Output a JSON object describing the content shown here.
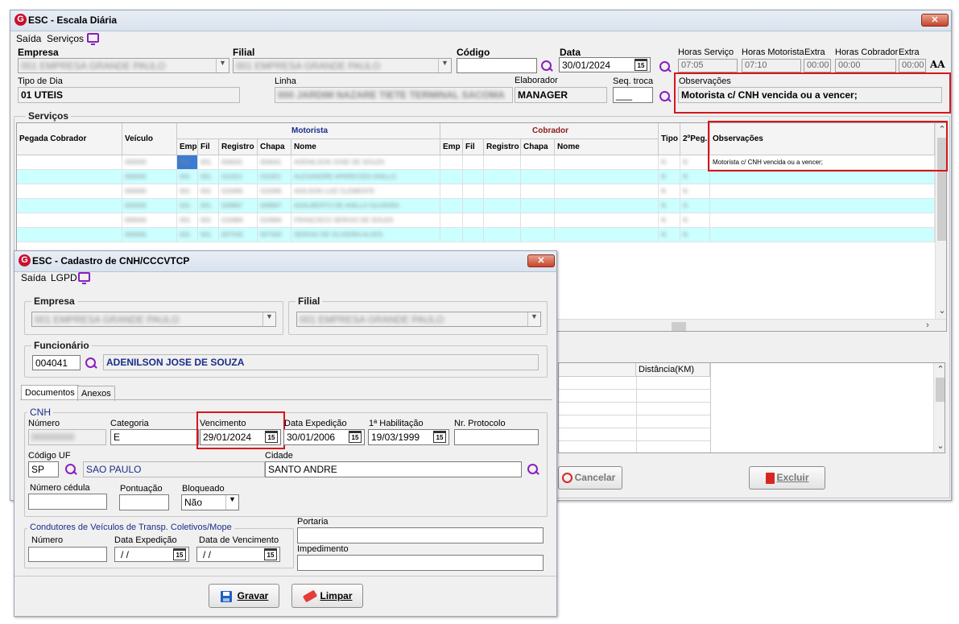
{
  "main": {
    "title": "ESC - Escala Diária",
    "close": "✕",
    "menu": [
      "Saída",
      "Serviços"
    ],
    "fields": {
      "empresa_label": "Empresa",
      "empresa_value": "001 EMPRESA GRANDE PAULO",
      "filial_label": "Filial",
      "filial_value": "001 EMPRESA GRANDE PAULO",
      "codigo_label": "Código",
      "data_label": "Data",
      "data_value": "30/01/2024",
      "horas_servico_label": "Horas Serviço",
      "horas_servico_value": "07:05",
      "horas_motorista_label": "Horas Motorista",
      "horas_motorista_value": "07:10",
      "extra_label": "Extra",
      "extra_motorista_value": "00:00",
      "horas_cobrador_label": "Horas Cobrador",
      "horas_cobrador_value": "00:00",
      "extra_cobrador_value": "00:00",
      "tipo_dia_label": "Tipo de Dia",
      "tipo_dia_value": "01 UTEIS",
      "linha_label": "Linha",
      "linha_value": "000 JARDIM NAZARE TIETE TERMINAL SACOMA",
      "elaborador_label": "Elaborador",
      "elaborador_value": "MANAGER",
      "seq_troca_label": "Seq. troca",
      "seq_troca_value": "___",
      "observacoes_label": "Observações",
      "observacoes_value": "Motorista c/ CNH vencida ou a vencer;"
    },
    "servicos": {
      "title": "Serviços",
      "headers": {
        "pegada_cobrador": "Pegada Cobrador",
        "veiculo": "Veículo",
        "motorista": "Motorista",
        "cobrador": "Cobrador",
        "emp": "Emp",
        "fil": "Fil",
        "registro": "Registro",
        "chapa": "Chapa",
        "nome": "Nome",
        "tipo": "Tipo",
        "peg2": "2ºPeg.",
        "observacoes": "Observações"
      },
      "rows": [
        {
          "veiculo": "000000",
          "emp": "001",
          "fil": "001",
          "registro": "004041",
          "chapa": "004041",
          "nome": "ADENILSON JOSE DE SOUZA",
          "tipo": "N",
          "peg2": "N",
          "obs": "Motorista c/ CNH vencida ou a vencer;"
        },
        {
          "veiculo": "000000",
          "emp": "001",
          "fil": "001",
          "registro": "011921",
          "chapa": "011921",
          "nome": "ALEXANDRE APARECIDO ANILLO",
          "tipo": "N",
          "peg2": "N",
          "obs": ""
        },
        {
          "veiculo": "000000",
          "emp": "001",
          "fil": "001",
          "registro": "010095",
          "chapa": "010095",
          "nome": "ADILSON LUIZ CLEMENTE",
          "tipo": "N",
          "peg2": "N",
          "obs": ""
        },
        {
          "veiculo": "000000",
          "emp": "001",
          "fil": "001",
          "registro": "009897",
          "chapa": "009897",
          "nome": "ADALBERTO DE ANILLO OLIVEIRA",
          "tipo": "N",
          "peg2": "N",
          "obs": ""
        },
        {
          "veiculo": "000000",
          "emp": "001",
          "fil": "001",
          "registro": "010684",
          "chapa": "010684",
          "nome": "FRANCISCO SERGIO DE SOUZA",
          "tipo": "N",
          "peg2": "N",
          "obs": ""
        },
        {
          "veiculo": "000000",
          "emp": "001",
          "fil": "001",
          "registro": "007540",
          "chapa": "007540",
          "nome": "SERGIO DE OLIVEIRA ALVES",
          "tipo": "N",
          "peg2": "N",
          "obs": ""
        }
      ]
    },
    "lower_grid": {
      "distancia_label": "Distância(KM)"
    },
    "buttons": {
      "cancelar": "Cancelar",
      "excluir": "Excluir"
    }
  },
  "cnh": {
    "title": "ESC - Cadastro de CNH/CCCVTCP",
    "close": "✕",
    "menu": [
      "Saída",
      "LGPD"
    ],
    "empresa_label": "Empresa",
    "empresa_value": "001 EMPRESA GRANDE PAULO",
    "filial_label": "Filial",
    "filial_value": "001 EMPRESA GRANDE PAULO",
    "funcionario_label": "Funcionário",
    "funcionario_codigo": "004041",
    "funcionario_nome": "ADENILSON JOSE DE SOUZA",
    "tabs": [
      "Documentos",
      "Anexos"
    ],
    "cnh_group": "CNH",
    "numero_label": "Número",
    "numero_value": "00000000",
    "categoria_label": "Categoria",
    "categoria_value": "E",
    "vencimento_label": "Vencimento",
    "vencimento_value": "29/01/2024",
    "data_expedicao_label": "Data Expedição",
    "data_expedicao_value": "30/01/2006",
    "habilitacao_label": "1ª Habilitação",
    "habilitacao_value": "19/03/1999",
    "protocolo_label": "Nr. Protocolo",
    "codigo_uf_label": "Código UF",
    "codigo_uf_value": "SP",
    "uf_nome": "SAO PAULO",
    "cidade_label": "Cidade",
    "cidade_value": "SANTO ANDRE",
    "numero_cedula_label": "Número cédula",
    "pontuacao_label": "Pontuação",
    "bloqueado_label": "Bloqueado",
    "bloqueado_value": "Não",
    "condutores_group": "Condutores de Veículos de Transp. Coletivos/Mope",
    "cond_numero_label": "Número",
    "cond_expedicao_label": "Data Expedição",
    "cond_expedicao_value": "/ /",
    "cond_vencimento_label": "Data de Vencimento",
    "cond_vencimento_value": "/ /",
    "portaria_label": "Portaria",
    "impedimento_label": "Impedimento",
    "gravar": "Gravar",
    "limpar": "Limpar"
  },
  "colors": {
    "highlight_red": "#d8151c",
    "row_cyan": "#ccffff",
    "icon_purple": "#8a1fbf",
    "brand_red": "#c8102e"
  }
}
